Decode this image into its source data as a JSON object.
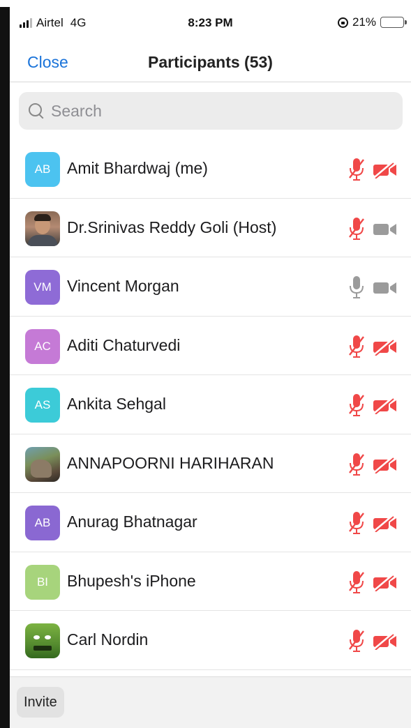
{
  "status_bar": {
    "carrier": "Airtel",
    "network": "4G",
    "time": "8:23 PM",
    "battery": "21%",
    "battery_level": 0.21
  },
  "nav": {
    "close_label": "Close",
    "title": "Participants (53)"
  },
  "search": {
    "placeholder": "Search"
  },
  "colors": {
    "accent": "#1a73d9",
    "muted_red": "#f04848",
    "inactive_gray": "#9b9b9b"
  },
  "participants": [
    {
      "initials": "AB",
      "name": "Amit Bhardwaj (me)",
      "avatar_color": "#4cc3f0",
      "mic": "muted",
      "video": "off"
    },
    {
      "initials": "",
      "name": "Dr.Srinivas Reddy Goli (Host)",
      "avatar_type": "photo-person",
      "mic": "muted",
      "video": "on"
    },
    {
      "initials": "VM",
      "name": "Vincent Morgan",
      "avatar_color": "#8e6bd6",
      "mic": "unmuted",
      "video": "on"
    },
    {
      "initials": "AC",
      "name": "Aditi Chaturvedi",
      "avatar_color": "#c57ad6",
      "mic": "muted",
      "video": "off"
    },
    {
      "initials": "AS",
      "name": "Ankita Sehgal",
      "avatar_color": "#3ccbd8",
      "mic": "muted",
      "video": "off"
    },
    {
      "initials": "",
      "name": "ANNAPOORNI HARIHARAN",
      "avatar_type": "photo-land",
      "mic": "muted",
      "video": "off"
    },
    {
      "initials": "AB",
      "name": "Anurag Bhatnagar",
      "avatar_color": "#8a68d2",
      "mic": "muted",
      "video": "off"
    },
    {
      "initials": "BI",
      "name": "Bhupesh's iPhone",
      "avatar_color": "#a7d47c",
      "mic": "muted",
      "video": "off"
    },
    {
      "initials": "",
      "name": "Carl Nordin",
      "avatar_type": "photo-green",
      "mic": "muted",
      "video": "off"
    }
  ],
  "bottom": {
    "invite_label": "Invite"
  }
}
